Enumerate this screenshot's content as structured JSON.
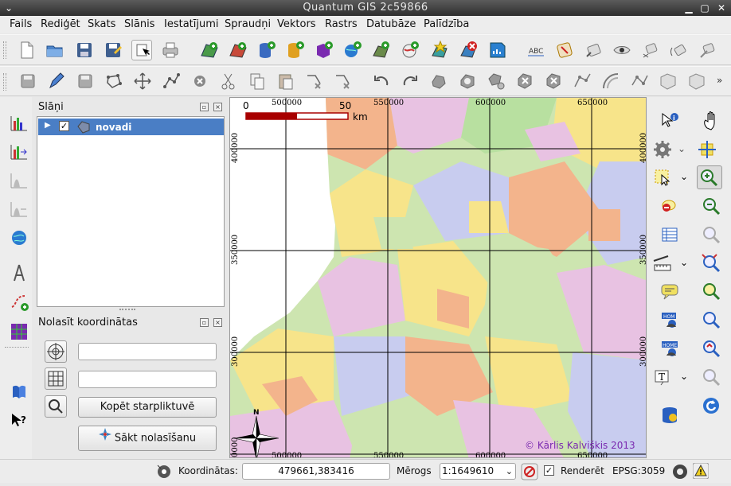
{
  "window": {
    "title": "Quantum GIS 2c59866"
  },
  "menu": [
    "Fails",
    "Rediģēt",
    "Skats",
    "Slānis",
    "Iestatījumi",
    "Spraudņi",
    "Vektors",
    "Rastrs",
    "Datubāze",
    "Palīdzība"
  ],
  "layers_panel": {
    "title": "Slāņi",
    "layers": [
      {
        "name": "novadi",
        "checked": true
      }
    ]
  },
  "coord_panel": {
    "title": "Nolasīt koordinātas",
    "field1_value": "",
    "field2_value": "",
    "copy_button": "Kopēt starpliktuvē",
    "start_button": "Sākt nolasīšanu"
  },
  "map": {
    "scalebar": {
      "min": "0",
      "max": "50",
      "unit": "km"
    },
    "x_ticks": [
      "500000",
      "550000",
      "600000",
      "650000"
    ],
    "y_ticks": [
      "400000",
      "350000",
      "300000"
    ],
    "corner_bottom_left": "0000",
    "north_label": "N",
    "copyright": "© Kārlis Kalviškis 2013"
  },
  "statusbar": {
    "coords_label": "Koordinātas:",
    "coords_value": "479661,383416",
    "scale_label": "Mērogs",
    "scale_value": "1:1649610",
    "render_label": "Renderēt",
    "render_checked": true,
    "crs": "EPSG:3059"
  },
  "colors": {
    "selection": "#4a7ec5",
    "map_water": "#ffffff",
    "scalebar_red": "#a80000"
  }
}
